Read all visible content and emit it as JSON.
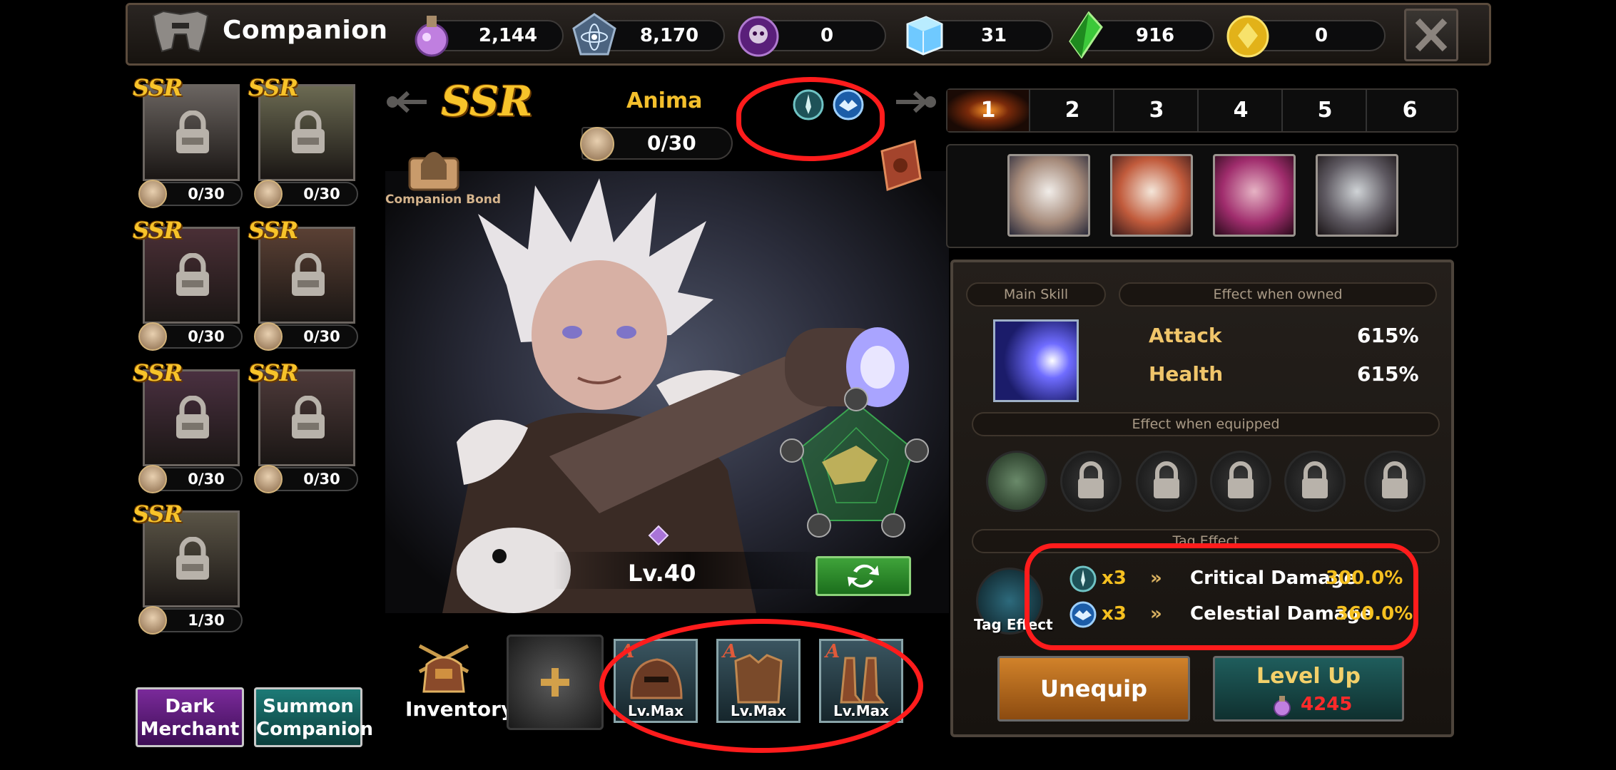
{
  "header": {
    "title": "Companion",
    "resources": [
      {
        "icon": "potion-icon",
        "value": "2,144"
      },
      {
        "icon": "atom-icon",
        "value": "8,170"
      },
      {
        "icon": "skull-token-icon",
        "value": "0"
      },
      {
        "icon": "ice-cube-icon",
        "value": "31"
      },
      {
        "icon": "green-crystal-icon",
        "value": "916"
      },
      {
        "icon": "gold-coin-icon",
        "value": "0"
      }
    ]
  },
  "companions": [
    {
      "rarity": "SSR",
      "count": "0/30"
    },
    {
      "rarity": "SSR",
      "count": "0/30"
    },
    {
      "rarity": "SSR",
      "count": "0/30"
    },
    {
      "rarity": "SSR",
      "count": "0/30"
    },
    {
      "rarity": "SSR",
      "count": "0/30"
    },
    {
      "rarity": "SSR",
      "count": "0/30"
    },
    {
      "rarity": "SSR",
      "count": "1/30"
    }
  ],
  "left_buttons": {
    "dark_merchant": "Dark\nMerchant",
    "summon": "Summon\nCompanion"
  },
  "selected": {
    "rarity": "SSR",
    "name": "Anima",
    "bond_count": "0/30",
    "bond_label": "Companion Bond",
    "level": "Lv.40"
  },
  "inventory": {
    "label": "Inventory",
    "gear": [
      {
        "grade": "A",
        "level": "Lv.Max"
      },
      {
        "grade": "A",
        "level": "Lv.Max"
      },
      {
        "grade": "A",
        "level": "Lv.Max"
      }
    ]
  },
  "tabs": [
    "1",
    "2",
    "3",
    "4",
    "5",
    "6"
  ],
  "active_tab": 0,
  "info": {
    "main_skill": "Main Skill",
    "effect_owned": "Effect when owned",
    "effect_equipped": "Effect when equipped",
    "tag_effect_header": "Tag Effect",
    "tag_effect_label": "Tag Effect",
    "stats": [
      {
        "name": "Attack",
        "value": "615%"
      },
      {
        "name": "Health",
        "value": "615%"
      }
    ],
    "tag_effects": [
      {
        "icon": "dagger-tag-icon",
        "mult": "x3",
        "name": "Critical Damage",
        "value": "300.0%"
      },
      {
        "icon": "celestial-tag-icon",
        "mult": "x3",
        "name": "Celestial Damage",
        "value": "360.0%"
      }
    ]
  },
  "actions": {
    "unequip": "Unequip",
    "level_up": "Level Up",
    "level_up_cost": "4245"
  },
  "colors": {
    "accent_gold": "#f3bf2c",
    "cost_red": "#ff2a2a",
    "annotation_red": "#ff1c1c"
  }
}
